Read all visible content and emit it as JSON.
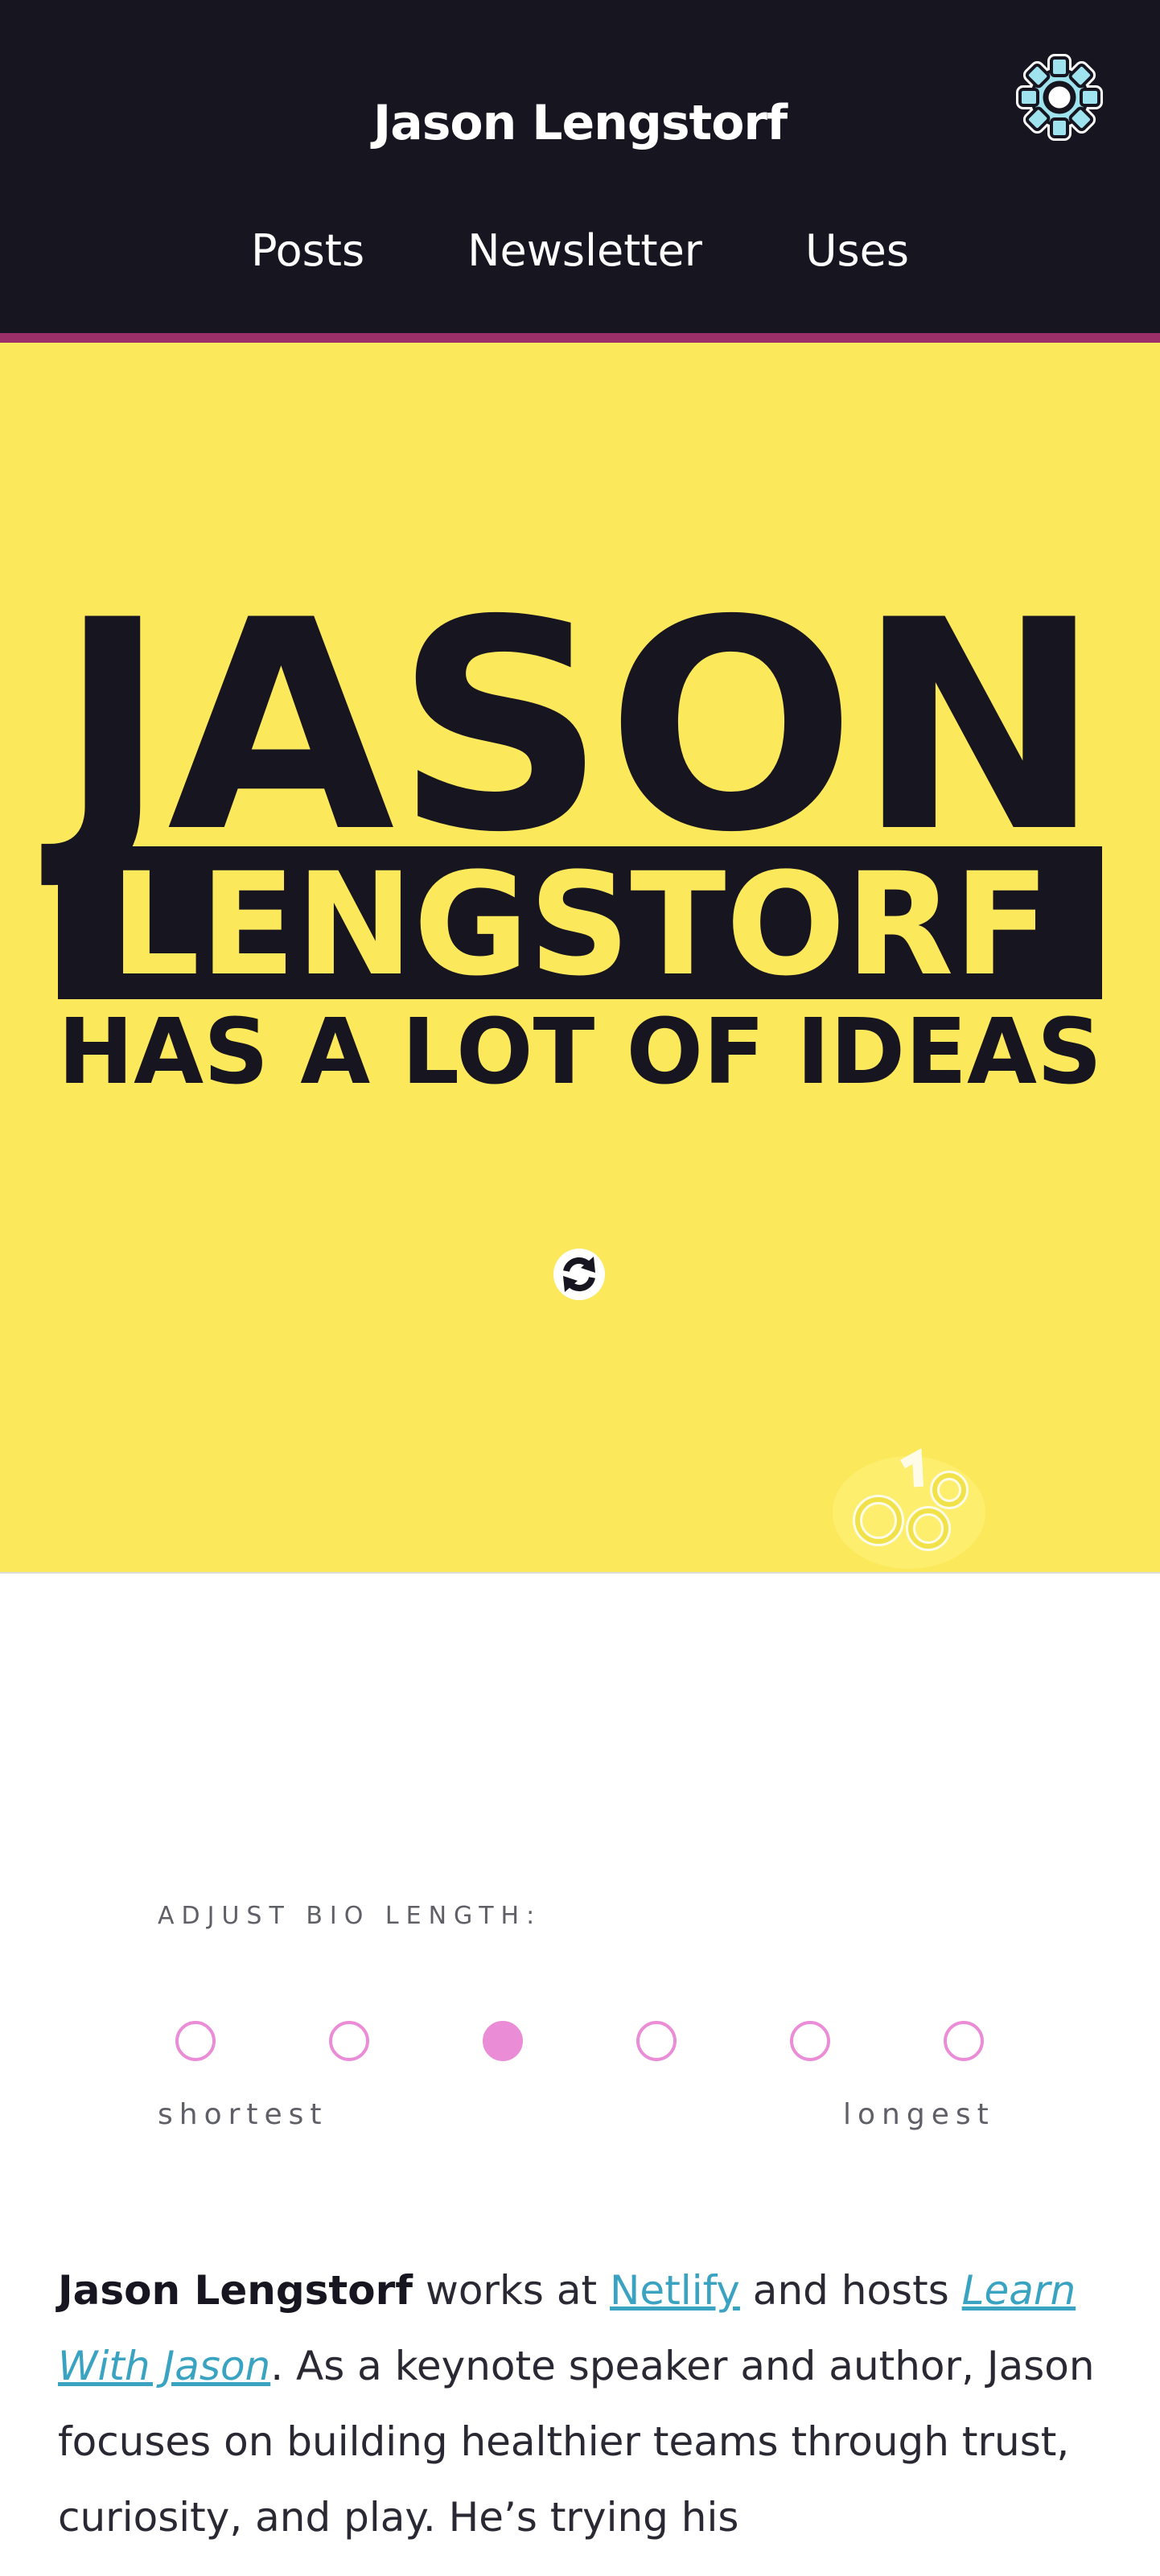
{
  "header": {
    "site_title": "Jason Lengstorf",
    "nav": [
      "Posts",
      "Newsletter",
      "Uses"
    ],
    "settings_icon": "gear-icon"
  },
  "hero": {
    "line1": "JASON",
    "line2": "LENGSTORF",
    "line3": "HAS A LOT OF IDEAS",
    "shuffle_icon": "shuffle-icon",
    "mascot_icon": "corgi-mascot-icon",
    "colors": {
      "background": "#fbe85b",
      "ink": "#17151f",
      "accent_bar": "#9c2f6a"
    }
  },
  "bio_length": {
    "label": "ADJUST BIO LENGTH:",
    "options": 6,
    "selected_index": 2,
    "min_label": "shortest",
    "max_label": "longest",
    "accent": "#ea8cd6"
  },
  "bio": {
    "name": "Jason Lengstorf",
    "t1": " works at ",
    "link1": "Netlify",
    "t2": " and hosts ",
    "link2": "Learn With Jason",
    "t3": ". As a keynote speaker and author, Jason focuses on building healthier teams through trust, curiosity, and play. He’s trying his",
    "link_color": "#3aa3c1"
  }
}
